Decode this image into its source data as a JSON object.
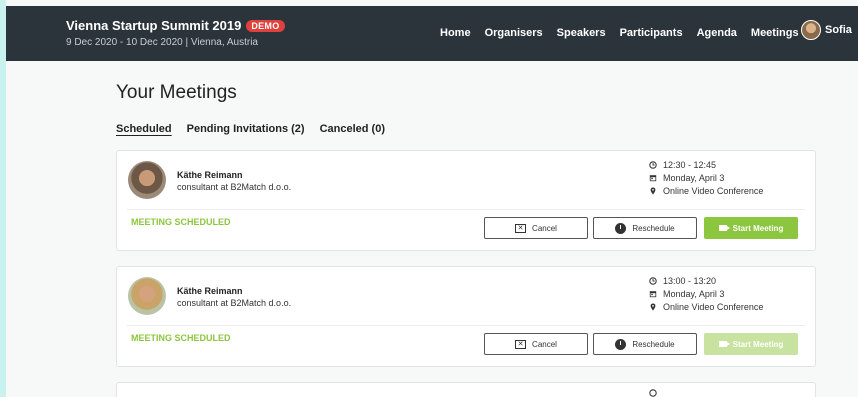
{
  "header": {
    "title": "Vienna Startup Summit 2019",
    "badge": "DEMO",
    "subtitle": "9 Dec 2020 - 10 Dec 2020 | Vienna, Austria",
    "nav": [
      "Home",
      "Organisers",
      "Speakers",
      "Participants",
      "Agenda",
      "Meetings"
    ],
    "user_name": "Sofia"
  },
  "page_title": "Your Meetings",
  "tabs": [
    "Scheduled",
    "Pending Invitations (2)",
    "Canceled (0)"
  ],
  "meetings": [
    {
      "name": "Käthe Reimann",
      "role": "consultant at B2Match d.o.o.",
      "time": "12:30 - 12:45",
      "date": "Monday, April 3",
      "location": "Online Video Conference",
      "status": "MEETING SCHEDULED",
      "cancel_label": "Cancel",
      "reschedule_label": "Reschedule",
      "start_label": "Start Meeting"
    },
    {
      "name": "Käthe Reimann",
      "role": "consultant at B2Match d.o.o.",
      "time": "13:00 - 13:20",
      "date": "Monday, April 3",
      "location": "Online Video Conference",
      "status": "MEETING SCHEDULED",
      "cancel_label": "Cancel",
      "reschedule_label": "Reschedule",
      "start_label": "Start Meeting"
    }
  ],
  "colors": {
    "header_bg": "#2b333b",
    "accent_green": "#8cc63f",
    "demo_red": "#e0413c"
  }
}
